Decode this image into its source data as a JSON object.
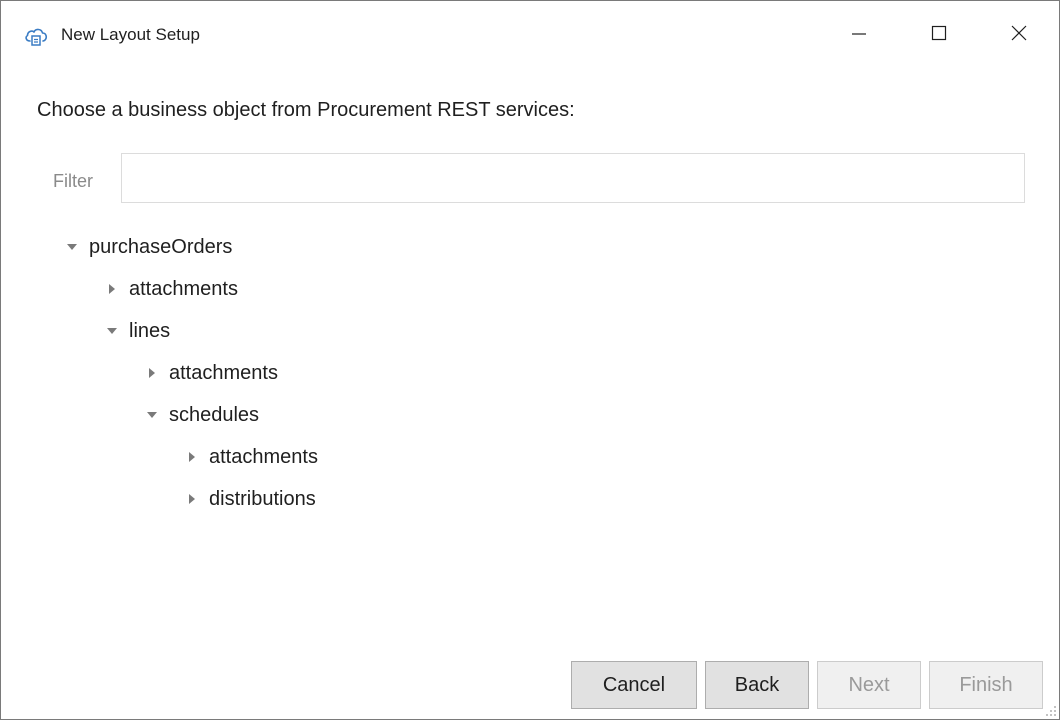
{
  "window": {
    "title": "New Layout Setup",
    "app_icon": "cloud-icon",
    "controls": {
      "minimize_icon": "minimize-icon",
      "maximize_icon": "maximize-icon",
      "close_icon": "close-icon"
    }
  },
  "main": {
    "heading": "Choose a business object from Procurement REST services:",
    "filter": {
      "label": "Filter",
      "value": "",
      "placeholder": ""
    }
  },
  "tree": [
    {
      "label": "purchaseOrders",
      "level": 0,
      "expanded": true
    },
    {
      "label": "attachments",
      "level": 1,
      "expanded": false
    },
    {
      "label": "lines",
      "level": 1,
      "expanded": true
    },
    {
      "label": "attachments",
      "level": 2,
      "expanded": false
    },
    {
      "label": "schedules",
      "level": 2,
      "expanded": true
    },
    {
      "label": "attachments",
      "level": 3,
      "expanded": false
    },
    {
      "label": "distributions",
      "level": 3,
      "expanded": false
    }
  ],
  "footer": {
    "cancel_label": "Cancel",
    "back_label": "Back",
    "next_label": "Next",
    "finish_label": "Finish"
  },
  "colors": {
    "text": "#1f1f1f",
    "muted": "#8a8a8a",
    "button_bg": "#e1e1e1",
    "button_border": "#adadad",
    "disabled_text": "#9a9a9a",
    "icon_accent": "#3a7cc4"
  }
}
